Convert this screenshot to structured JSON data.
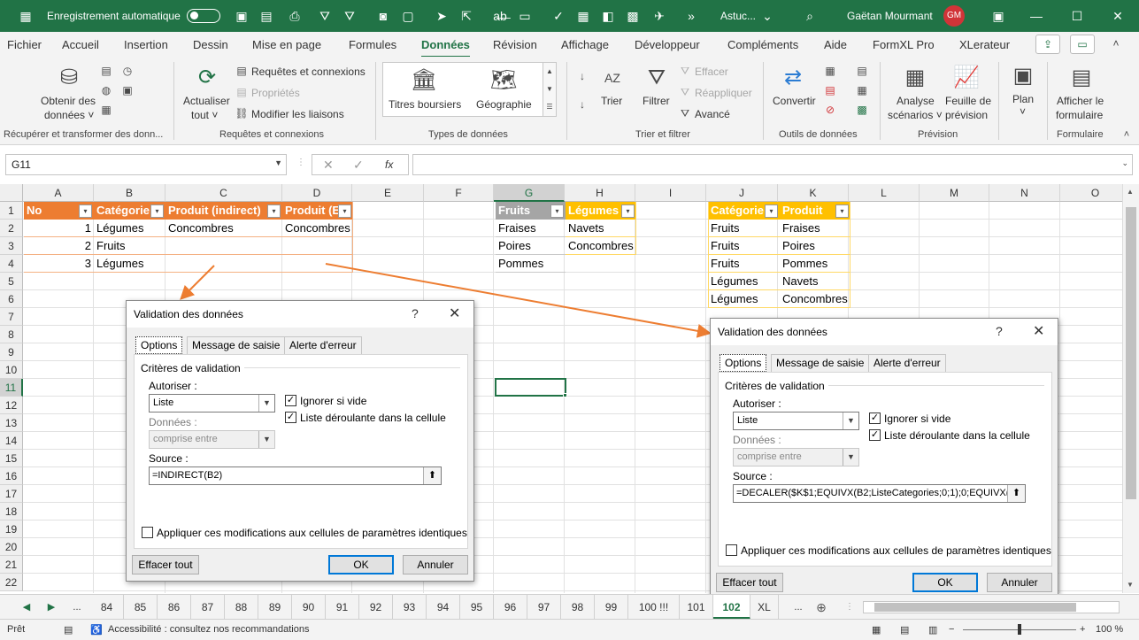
{
  "titlebar": {
    "autosave_label": "Enregistrement automatique",
    "doc_title": "Astuc...",
    "user_name": "Gaëtan Mourmant",
    "avatar_initials": "GM",
    "minimize": "—",
    "maximize": "☐",
    "close": "✕"
  },
  "tabs": [
    "Fichier",
    "Accueil",
    "Insertion",
    "Dessin",
    "Mise en page",
    "Formules",
    "Données",
    "Révision",
    "Affichage",
    "Développeur",
    "Compléments",
    "Aide",
    "FormXL Pro",
    "XLerateur"
  ],
  "active_tab": "Données",
  "ribbon": {
    "get_data_label1": "Obtenir des",
    "get_data_label2": "données ˅",
    "refresh_label1": "Actualiser",
    "refresh_label2": "tout ˅",
    "queries_connections": "Requêtes et connexions",
    "properties": "Propriétés",
    "edit_links": "Modifier les liaisons",
    "stocks": "Titres boursiers",
    "geography": "Géographie",
    "sort": "Trier",
    "filter": "Filtrer",
    "clear": "Effacer",
    "reapply": "Réappliquer",
    "advanced": "Avancé",
    "convert": "Convertir",
    "whatif_label1": "Analyse",
    "whatif_label2": "scénarios ˅",
    "forecast_label1": "Feuille de",
    "forecast_label2": "prévision",
    "outline_label": "Plan",
    "outline_arrow": "˅",
    "show_form_label1": "Afficher le",
    "show_form_label2": "formulaire",
    "groups": {
      "get_transform": "Récupérer et transformer des donn...",
      "queries": "Requêtes et connexions",
      "data_types": "Types de données",
      "sort_filter": "Trier et filtrer",
      "data_tools": "Outils de données",
      "forecast": "Prévision",
      "form": "Formulaire"
    }
  },
  "formula_bar": {
    "name_box": "G11",
    "cancel": "✕",
    "enter": "✓",
    "fx": "fx",
    "formula": ""
  },
  "grid": {
    "columns": [
      "A",
      "B",
      "C",
      "D",
      "E",
      "F",
      "G",
      "H",
      "I",
      "J",
      "K",
      "L",
      "M",
      "N",
      "O"
    ],
    "rows": [
      "1",
      "2",
      "3",
      "4",
      "5",
      "6",
      "7",
      "8",
      "9",
      "10",
      "11",
      "12",
      "13",
      "14",
      "15",
      "16",
      "17",
      "18",
      "19",
      "20",
      "21",
      "22"
    ],
    "table1": {
      "headers": [
        "No",
        "Catégorie",
        "Produit (indirect)",
        "Produit (E"
      ],
      "rows": [
        [
          "1",
          "Légumes",
          "Concombres",
          "Concombres"
        ],
        [
          "2",
          "Fruits",
          "",
          ""
        ],
        [
          "3",
          "Légumes",
          "",
          ""
        ]
      ]
    },
    "table2": {
      "headers": [
        "Fruits",
        "Légumes"
      ],
      "rows": [
        [
          "Fraises",
          "Navets"
        ],
        [
          "Poires",
          "Concombres"
        ],
        [
          "Pommes",
          ""
        ]
      ]
    },
    "table3": {
      "headers": [
        "Catégorie",
        "Produit"
      ],
      "rows": [
        [
          "Fruits",
          "Fraises"
        ],
        [
          "Fruits",
          "Poires"
        ],
        [
          "Fruits",
          "Pommes"
        ],
        [
          "Légumes",
          "Navets"
        ],
        [
          "Légumes",
          "Concombres"
        ]
      ]
    },
    "filter_glyph": "▾"
  },
  "dialog_left": {
    "title": "Validation des données",
    "help": "?",
    "close": "✕",
    "tabs": [
      "Options",
      "Message de saisie",
      "Alerte d'erreur"
    ],
    "section": "Critères de validation",
    "allow_label": "Autoriser :",
    "allow_value": "Liste",
    "ignore_blank": "Ignorer si vide",
    "in_cell_dropdown": "Liste déroulante dans la cellule",
    "data_label": "Données :",
    "data_value": "comprise entre",
    "source_label": "Source :",
    "source_value": "=INDIRECT(B2)",
    "apply_all": "Appliquer ces modifications aux cellules de paramètres identiques",
    "clear_all": "Effacer tout",
    "ok": "OK",
    "cancel": "Annuler",
    "check_mark": "✓",
    "arrow_glyph": "▼",
    "collapse_glyph": "⬆"
  },
  "dialog_right": {
    "title": "Validation des données",
    "help": "?",
    "close": "✕",
    "tabs": [
      "Options",
      "Message de saisie",
      "Alerte d'erreur"
    ],
    "section": "Critères de validation",
    "allow_label": "Autoriser :",
    "allow_value": "Liste",
    "ignore_blank": "Ignorer si vide",
    "in_cell_dropdown": "Liste déroulante dans la cellule",
    "data_label": "Données :",
    "data_value": "comprise entre",
    "source_label": "Source :",
    "source_value": "=DECALER($K$1;EQUIVX(B2;ListeCategories;0;1);0;EQUIVX(B",
    "apply_all": "Appliquer ces modifications aux cellules de paramètres identiques",
    "clear_all": "Effacer tout",
    "ok": "OK",
    "cancel": "Annuler",
    "check_mark": "✓",
    "arrow_glyph": "▼",
    "collapse_glyph": "⬆"
  },
  "sheet_tabs": {
    "nav_prev": "◀",
    "nav_next": "▶",
    "ellipsis": "...",
    "tabs": [
      "84",
      "85",
      "86",
      "87",
      "88",
      "89",
      "90",
      "91",
      "92",
      "93",
      "94",
      "95",
      "96",
      "97",
      "98",
      "99",
      "100 !!!",
      "101",
      "102",
      "XL"
    ],
    "active": "102",
    "more": "...",
    "add": "⊕"
  },
  "status_bar": {
    "ready": "Prêt",
    "accessibility": "Accessibilité : consultez nos recommandations",
    "zoom": "100 %",
    "zoom_minus": "−",
    "zoom_plus": "+"
  },
  "colors": {
    "excel_green": "#217346",
    "orange_header": "#ed7d31",
    "grey_header": "#a5a5a5",
    "gold_header": "#ffc000",
    "arrow_orange": "#ed7d31"
  },
  "icons": {
    "save": "save-icon",
    "undo": "undo-icon",
    "search": "search-icon"
  }
}
